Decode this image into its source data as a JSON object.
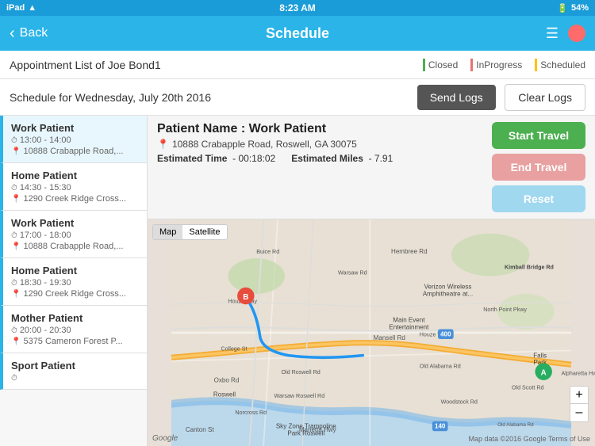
{
  "statusBar": {
    "carrier": "iPad",
    "time": "8:23 AM",
    "battery": "54%",
    "wifi": true
  },
  "navBar": {
    "backLabel": "Back",
    "title": "Schedule"
  },
  "appointmentHeader": {
    "title": "Appointment List of Joe Bond1",
    "legend": {
      "closed": "Closed",
      "inProgress": "InProgress",
      "scheduled": "Scheduled"
    }
  },
  "scheduleHeader": {
    "dateLabel": "Schedule for Wednesday, July 20th 2016",
    "sendLogsLabel": "Send Logs",
    "clearLogsLabel": "Clear Logs"
  },
  "appointments": [
    {
      "name": "Work Patient",
      "type": "work",
      "time": "13:00 - 14:00",
      "address": "10888 Crabapple Road,...",
      "active": true
    },
    {
      "name": "Home Patient",
      "type": "home",
      "time": "14:30 - 15:30",
      "address": "1290 Creek Ridge Cross...",
      "active": false
    },
    {
      "name": "Work Patient",
      "type": "work",
      "time": "17:00 - 18:00",
      "address": "10888 Crabapple Road,...",
      "active": false
    },
    {
      "name": "Home Patient",
      "type": "home",
      "time": "18:30 - 19:30",
      "address": "1290 Creek Ridge Cross...",
      "active": false
    },
    {
      "name": "Mother Patient",
      "type": "mother",
      "time": "20:00 - 20:30",
      "address": "5375 Cameron Forest P...",
      "active": false
    },
    {
      "name": "Sport Patient",
      "type": "sport",
      "time": "",
      "address": "",
      "active": false
    }
  ],
  "patientInfo": {
    "nameLabel": "Patient Name : Work Patient",
    "address": "10888 Crabapple Road, Roswell, GA 30075",
    "estimatedTimeLabel": "Estimated Time",
    "estimatedTimeValue": "00:18:02",
    "estimatedMilesLabel": "Estimated Miles",
    "estimatedMilesValue": "7.91"
  },
  "actionButtons": {
    "startTravel": "Start Travel",
    "endTravel": "End Travel",
    "reset": "Reset"
  },
  "map": {
    "mapTab": "Map",
    "satelliteTab": "Satellite",
    "googleLabel": "Google",
    "attribution": "Map data ©2016 Google  Terms of Use",
    "zoomIn": "+",
    "zoomOut": "–"
  }
}
